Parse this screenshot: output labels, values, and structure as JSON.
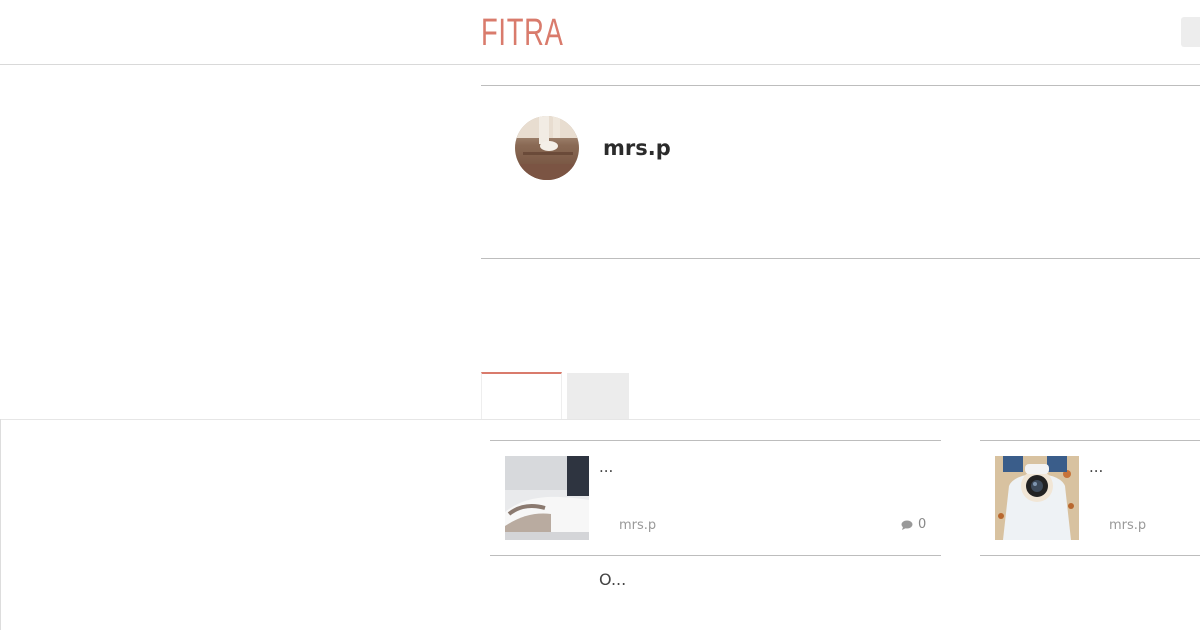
{
  "header": {
    "logo": "FITRA"
  },
  "profile": {
    "username": "mrs.p"
  },
  "tabs": [
    {
      "label": ""
    },
    {
      "label": ""
    }
  ],
  "posts": [
    {
      "title": "...",
      "author": "mrs.p",
      "comment_count": "0"
    },
    {
      "title": "...",
      "author": "mrs.p"
    },
    {
      "title": "O..."
    }
  ],
  "colors": {
    "brand": "#d97b6c",
    "rule": "#bdbdbd",
    "muted_text": "#999999"
  }
}
